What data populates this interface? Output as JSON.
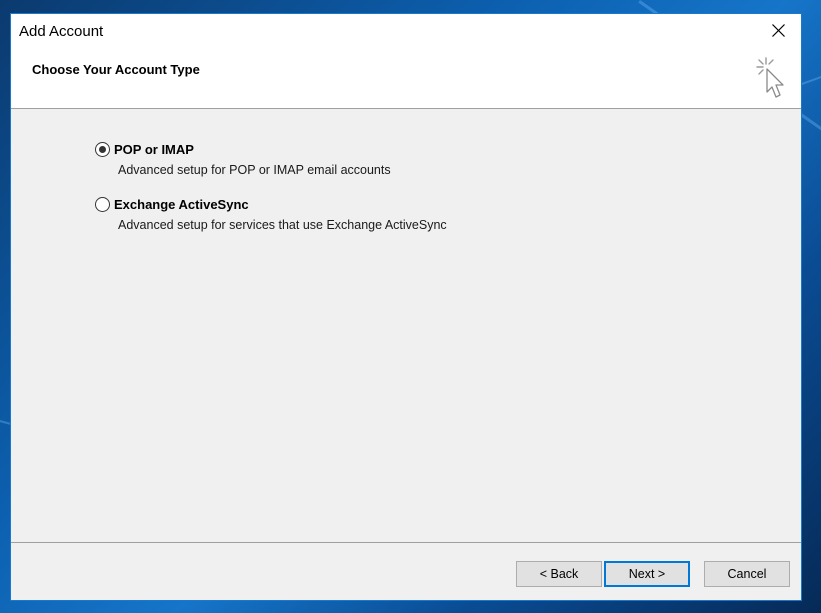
{
  "window": {
    "title": "Add Account",
    "header_title": "Choose Your Account Type"
  },
  "options": [
    {
      "label": "POP or IMAP",
      "description": "Advanced setup for POP or IMAP email accounts",
      "selected": true
    },
    {
      "label": "Exchange ActiveSync",
      "description": "Advanced setup for services that use Exchange ActiveSync",
      "selected": false
    }
  ],
  "buttons": {
    "back": "< Back",
    "next": "Next >",
    "cancel": "Cancel"
  },
  "icons": {
    "close": "close-icon",
    "wizard": "cursor-click-icon"
  },
  "colors": {
    "accent": "#0078d7",
    "window_border": "#1979ca",
    "dialog_bg": "#f0f0f0"
  }
}
